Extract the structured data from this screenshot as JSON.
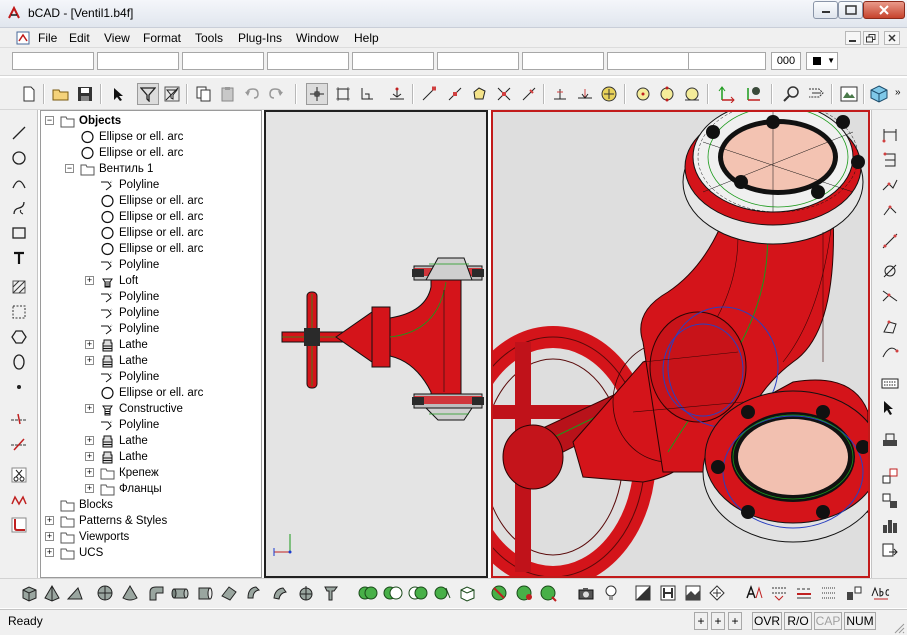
{
  "window": {
    "title": "bCAD - [Ventil1.b4f]"
  },
  "menu": [
    "File",
    "Edit",
    "View",
    "Format",
    "Tools",
    "Plug-Ins",
    "Window",
    "Help"
  ],
  "propbar": {
    "linewidth_value": "000"
  },
  "tree": {
    "root": "Objects",
    "items": [
      {
        "label": "Ellipse or ell. arc",
        "icon": "ellipse-icon",
        "depth": 1
      },
      {
        "label": "Ellipse or ell. arc",
        "icon": "ellipse-icon",
        "depth": 1
      },
      {
        "label": "Вентиль 1",
        "icon": "folder-icon",
        "depth": 1,
        "expanded": true
      },
      {
        "label": "Polyline",
        "icon": "polyline-icon",
        "depth": 2
      },
      {
        "label": "Ellipse or ell. arc",
        "icon": "ellipse-icon",
        "depth": 2
      },
      {
        "label": "Ellipse or ell. arc",
        "icon": "ellipse-icon",
        "depth": 2
      },
      {
        "label": "Ellipse or ell. arc",
        "icon": "ellipse-icon",
        "depth": 2
      },
      {
        "label": "Ellipse or ell. arc",
        "icon": "ellipse-icon",
        "depth": 2
      },
      {
        "label": "Polyline",
        "icon": "polyline-icon",
        "depth": 2
      },
      {
        "label": "Loft",
        "icon": "loft-icon",
        "depth": 2,
        "collapsed": true
      },
      {
        "label": "Polyline",
        "icon": "polyline-icon",
        "depth": 2
      },
      {
        "label": "Polyline",
        "icon": "polyline-icon",
        "depth": 2
      },
      {
        "label": "Polyline",
        "icon": "polyline-icon",
        "depth": 2
      },
      {
        "label": "Lathe",
        "icon": "lathe-icon",
        "depth": 2,
        "collapsed": true
      },
      {
        "label": "Lathe",
        "icon": "lathe-icon",
        "depth": 2,
        "collapsed": true
      },
      {
        "label": "Polyline",
        "icon": "polyline-icon",
        "depth": 2
      },
      {
        "label": "Ellipse or ell. arc",
        "icon": "ellipse-icon",
        "depth": 2
      },
      {
        "label": "Constructive",
        "icon": "constructive-icon",
        "depth": 2,
        "collapsed": true
      },
      {
        "label": "Polyline",
        "icon": "polyline-icon",
        "depth": 2
      },
      {
        "label": "Lathe",
        "icon": "lathe-icon",
        "depth": 2,
        "collapsed": true
      },
      {
        "label": "Lathe",
        "icon": "lathe-icon",
        "depth": 2,
        "collapsed": true
      },
      {
        "label": "Крепеж",
        "icon": "folder-icon",
        "depth": 2,
        "collapsed": true
      },
      {
        "label": "Фланцы",
        "icon": "folder-icon",
        "depth": 2,
        "collapsed": true
      },
      {
        "label": "Blocks",
        "icon": "folder-icon",
        "depth": 0
      },
      {
        "label": "Patterns & Styles",
        "icon": "folder-icon",
        "depth": 0,
        "collapsed": true
      },
      {
        "label": "Viewports",
        "icon": "folder-icon",
        "depth": 0,
        "collapsed": true
      },
      {
        "label": "UCS",
        "icon": "folder-icon",
        "depth": 0,
        "collapsed": true
      }
    ]
  },
  "status": {
    "text": "Ready",
    "cells": [
      "+",
      "+",
      "+",
      "OVR",
      "R/O",
      "CAP",
      "NUM"
    ],
    "disabled_cell": "CAP"
  },
  "colors": {
    "accent_red": "#d4141a",
    "active_view_border": "#c21a1a"
  }
}
